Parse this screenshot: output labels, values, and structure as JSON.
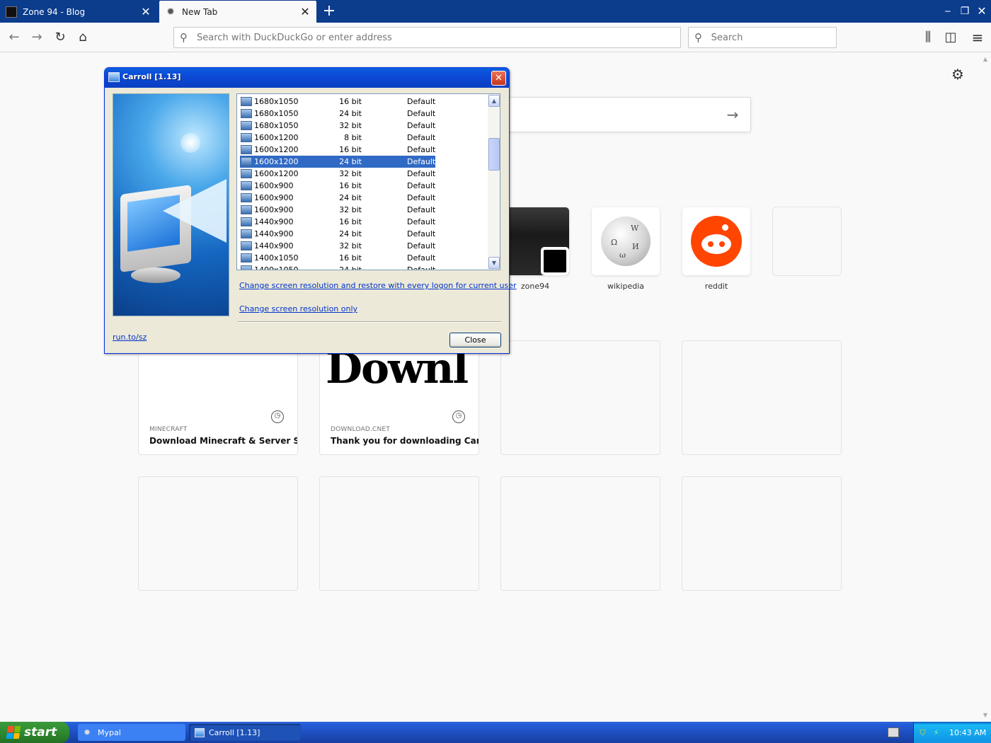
{
  "browser": {
    "tabs": [
      {
        "title": "Zone 94 - Blog"
      },
      {
        "title": "New Tab"
      }
    ],
    "urlbar_placeholder": "Search with DuckDuckGo or enter address",
    "searchbar_placeholder": "Search"
  },
  "newtab": {
    "top_sites": [
      {
        "label": "zone94"
      },
      {
        "label": "wikipedia"
      },
      {
        "label": "reddit"
      }
    ],
    "highlights": [
      {
        "source": "MINECRAFT",
        "title": "Download Minecraft & Server S..."
      },
      {
        "source": "DOWNLOAD.CNET",
        "title": "Thank you for downloading Carr...",
        "thumb_text": "Downl"
      }
    ]
  },
  "dialog": {
    "title": "Carroll [1.13]",
    "modes": [
      {
        "res": "1680x1050",
        "bits": "16 bit",
        "freq": "Default"
      },
      {
        "res": "1680x1050",
        "bits": "24 bit",
        "freq": "Default"
      },
      {
        "res": "1680x1050",
        "bits": "32 bit",
        "freq": "Default"
      },
      {
        "res": "1600x1200",
        "bits": "8 bit",
        "freq": "Default"
      },
      {
        "res": "1600x1200",
        "bits": "16 bit",
        "freq": "Default"
      },
      {
        "res": "1600x1200",
        "bits": "24 bit",
        "freq": "Default",
        "selected": true
      },
      {
        "res": "1600x1200",
        "bits": "32 bit",
        "freq": "Default"
      },
      {
        "res": "1600x900",
        "bits": "16 bit",
        "freq": "Default"
      },
      {
        "res": "1600x900",
        "bits": "24 bit",
        "freq": "Default"
      },
      {
        "res": "1600x900",
        "bits": "32 bit",
        "freq": "Default"
      },
      {
        "res": "1440x900",
        "bits": "16 bit",
        "freq": "Default"
      },
      {
        "res": "1440x900",
        "bits": "24 bit",
        "freq": "Default"
      },
      {
        "res": "1440x900",
        "bits": "32 bit",
        "freq": "Default"
      },
      {
        "res": "1400x1050",
        "bits": "16 bit",
        "freq": "Default"
      },
      {
        "res": "1400x1050",
        "bits": "24 bit",
        "freq": "Default"
      }
    ],
    "link_restore": "Change screen resolution and restore with every logon for current user",
    "link_only": "Change screen resolution only",
    "link_runto": "run.to/sz",
    "close_label": "Close"
  },
  "taskbar": {
    "start_label": "start",
    "tasks": [
      {
        "label": "Mypal"
      },
      {
        "label": "Carroll [1.13]"
      }
    ],
    "clock": "10:43 AM"
  },
  "colors": {
    "xp_blue": "#0c3c8c",
    "selection": "#316ac5",
    "reddit": "#ff4500",
    "link": "#0033cc"
  }
}
